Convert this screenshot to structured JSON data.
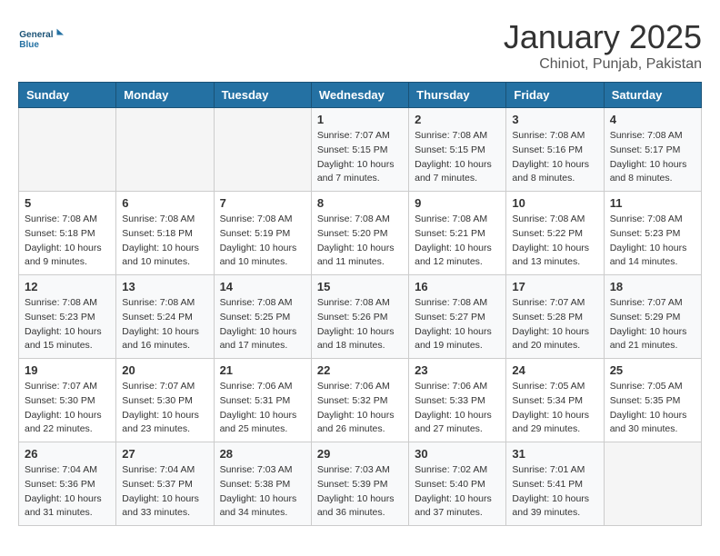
{
  "header": {
    "logo_line1": "General",
    "logo_line2": "Blue",
    "title": "January 2025",
    "subtitle": "Chiniot, Punjab, Pakistan"
  },
  "weekdays": [
    "Sunday",
    "Monday",
    "Tuesday",
    "Wednesday",
    "Thursday",
    "Friday",
    "Saturday"
  ],
  "weeks": [
    [
      {
        "day": "",
        "sunrise": "",
        "sunset": "",
        "daylight": ""
      },
      {
        "day": "",
        "sunrise": "",
        "sunset": "",
        "daylight": ""
      },
      {
        "day": "",
        "sunrise": "",
        "sunset": "",
        "daylight": ""
      },
      {
        "day": "1",
        "sunrise": "Sunrise: 7:07 AM",
        "sunset": "Sunset: 5:15 PM",
        "daylight": "Daylight: 10 hours and 7 minutes."
      },
      {
        "day": "2",
        "sunrise": "Sunrise: 7:08 AM",
        "sunset": "Sunset: 5:15 PM",
        "daylight": "Daylight: 10 hours and 7 minutes."
      },
      {
        "day": "3",
        "sunrise": "Sunrise: 7:08 AM",
        "sunset": "Sunset: 5:16 PM",
        "daylight": "Daylight: 10 hours and 8 minutes."
      },
      {
        "day": "4",
        "sunrise": "Sunrise: 7:08 AM",
        "sunset": "Sunset: 5:17 PM",
        "daylight": "Daylight: 10 hours and 8 minutes."
      }
    ],
    [
      {
        "day": "5",
        "sunrise": "Sunrise: 7:08 AM",
        "sunset": "Sunset: 5:18 PM",
        "daylight": "Daylight: 10 hours and 9 minutes."
      },
      {
        "day": "6",
        "sunrise": "Sunrise: 7:08 AM",
        "sunset": "Sunset: 5:18 PM",
        "daylight": "Daylight: 10 hours and 10 minutes."
      },
      {
        "day": "7",
        "sunrise": "Sunrise: 7:08 AM",
        "sunset": "Sunset: 5:19 PM",
        "daylight": "Daylight: 10 hours and 10 minutes."
      },
      {
        "day": "8",
        "sunrise": "Sunrise: 7:08 AM",
        "sunset": "Sunset: 5:20 PM",
        "daylight": "Daylight: 10 hours and 11 minutes."
      },
      {
        "day": "9",
        "sunrise": "Sunrise: 7:08 AM",
        "sunset": "Sunset: 5:21 PM",
        "daylight": "Daylight: 10 hours and 12 minutes."
      },
      {
        "day": "10",
        "sunrise": "Sunrise: 7:08 AM",
        "sunset": "Sunset: 5:22 PM",
        "daylight": "Daylight: 10 hours and 13 minutes."
      },
      {
        "day": "11",
        "sunrise": "Sunrise: 7:08 AM",
        "sunset": "Sunset: 5:23 PM",
        "daylight": "Daylight: 10 hours and 14 minutes."
      }
    ],
    [
      {
        "day": "12",
        "sunrise": "Sunrise: 7:08 AM",
        "sunset": "Sunset: 5:23 PM",
        "daylight": "Daylight: 10 hours and 15 minutes."
      },
      {
        "day": "13",
        "sunrise": "Sunrise: 7:08 AM",
        "sunset": "Sunset: 5:24 PM",
        "daylight": "Daylight: 10 hours and 16 minutes."
      },
      {
        "day": "14",
        "sunrise": "Sunrise: 7:08 AM",
        "sunset": "Sunset: 5:25 PM",
        "daylight": "Daylight: 10 hours and 17 minutes."
      },
      {
        "day": "15",
        "sunrise": "Sunrise: 7:08 AM",
        "sunset": "Sunset: 5:26 PM",
        "daylight": "Daylight: 10 hours and 18 minutes."
      },
      {
        "day": "16",
        "sunrise": "Sunrise: 7:08 AM",
        "sunset": "Sunset: 5:27 PM",
        "daylight": "Daylight: 10 hours and 19 minutes."
      },
      {
        "day": "17",
        "sunrise": "Sunrise: 7:07 AM",
        "sunset": "Sunset: 5:28 PM",
        "daylight": "Daylight: 10 hours and 20 minutes."
      },
      {
        "day": "18",
        "sunrise": "Sunrise: 7:07 AM",
        "sunset": "Sunset: 5:29 PM",
        "daylight": "Daylight: 10 hours and 21 minutes."
      }
    ],
    [
      {
        "day": "19",
        "sunrise": "Sunrise: 7:07 AM",
        "sunset": "Sunset: 5:30 PM",
        "daylight": "Daylight: 10 hours and 22 minutes."
      },
      {
        "day": "20",
        "sunrise": "Sunrise: 7:07 AM",
        "sunset": "Sunset: 5:30 PM",
        "daylight": "Daylight: 10 hours and 23 minutes."
      },
      {
        "day": "21",
        "sunrise": "Sunrise: 7:06 AM",
        "sunset": "Sunset: 5:31 PM",
        "daylight": "Daylight: 10 hours and 25 minutes."
      },
      {
        "day": "22",
        "sunrise": "Sunrise: 7:06 AM",
        "sunset": "Sunset: 5:32 PM",
        "daylight": "Daylight: 10 hours and 26 minutes."
      },
      {
        "day": "23",
        "sunrise": "Sunrise: 7:06 AM",
        "sunset": "Sunset: 5:33 PM",
        "daylight": "Daylight: 10 hours and 27 minutes."
      },
      {
        "day": "24",
        "sunrise": "Sunrise: 7:05 AM",
        "sunset": "Sunset: 5:34 PM",
        "daylight": "Daylight: 10 hours and 29 minutes."
      },
      {
        "day": "25",
        "sunrise": "Sunrise: 7:05 AM",
        "sunset": "Sunset: 5:35 PM",
        "daylight": "Daylight: 10 hours and 30 minutes."
      }
    ],
    [
      {
        "day": "26",
        "sunrise": "Sunrise: 7:04 AM",
        "sunset": "Sunset: 5:36 PM",
        "daylight": "Daylight: 10 hours and 31 minutes."
      },
      {
        "day": "27",
        "sunrise": "Sunrise: 7:04 AM",
        "sunset": "Sunset: 5:37 PM",
        "daylight": "Daylight: 10 hours and 33 minutes."
      },
      {
        "day": "28",
        "sunrise": "Sunrise: 7:03 AM",
        "sunset": "Sunset: 5:38 PM",
        "daylight": "Daylight: 10 hours and 34 minutes."
      },
      {
        "day": "29",
        "sunrise": "Sunrise: 7:03 AM",
        "sunset": "Sunset: 5:39 PM",
        "daylight": "Daylight: 10 hours and 36 minutes."
      },
      {
        "day": "30",
        "sunrise": "Sunrise: 7:02 AM",
        "sunset": "Sunset: 5:40 PM",
        "daylight": "Daylight: 10 hours and 37 minutes."
      },
      {
        "day": "31",
        "sunrise": "Sunrise: 7:01 AM",
        "sunset": "Sunset: 5:41 PM",
        "daylight": "Daylight: 10 hours and 39 minutes."
      },
      {
        "day": "",
        "sunrise": "",
        "sunset": "",
        "daylight": ""
      }
    ]
  ]
}
